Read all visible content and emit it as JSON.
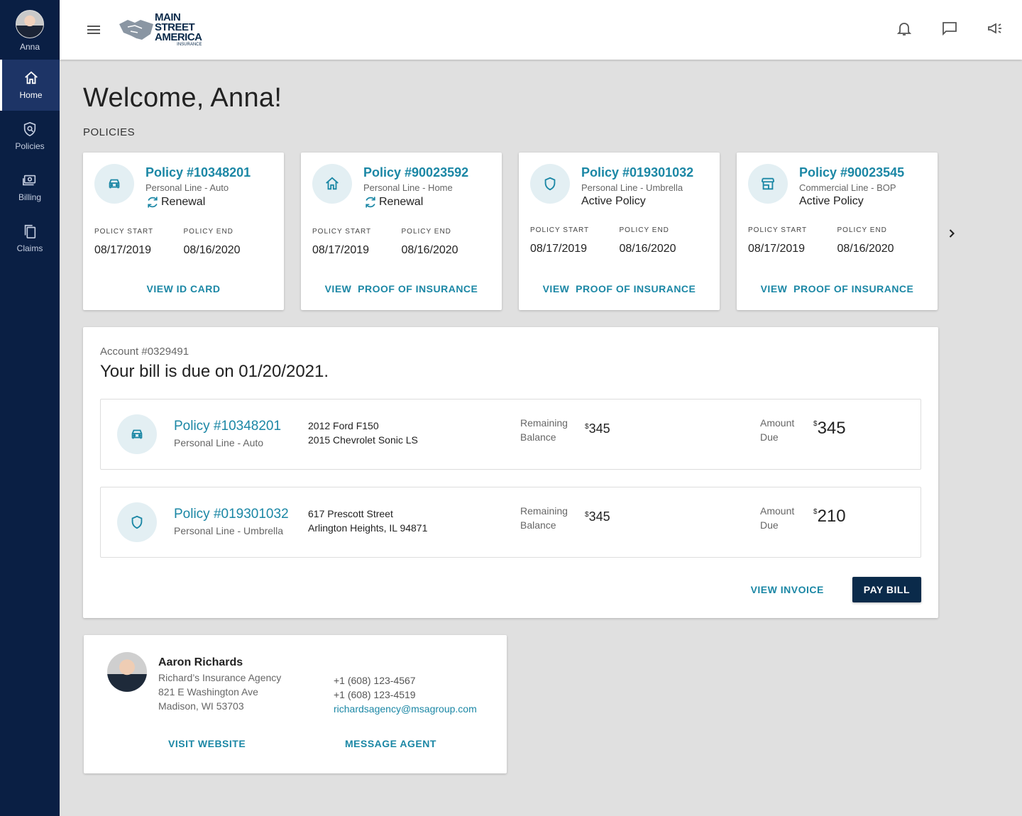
{
  "sidebar": {
    "user_name": "Anna",
    "items": [
      {
        "label": "Home",
        "icon": "home-icon",
        "active": true
      },
      {
        "label": "Policies",
        "icon": "policy-shield-icon",
        "active": false
      },
      {
        "label": "Billing",
        "icon": "billing-icon",
        "active": false
      },
      {
        "label": "Claims",
        "icon": "claims-icon",
        "active": false
      }
    ]
  },
  "header": {
    "logo_lines": [
      "MAIN",
      "STREET",
      "AMERICA"
    ],
    "logo_sub": "INSURANCE",
    "icons": [
      "bell-icon",
      "chat-icon",
      "megaphone-icon"
    ]
  },
  "main": {
    "welcome": "Welcome, Anna!",
    "policies_title": "POLICIES"
  },
  "policies": [
    {
      "number": "Policy #10348201",
      "line": "Personal Line - Auto",
      "status": "Renewal",
      "renewal": true,
      "icon": "car-icon",
      "start_label": "POLICY START",
      "start": "08/17/2019",
      "end_label": "POLICY END",
      "end": "08/16/2020",
      "link": "VIEW ID CARD"
    },
    {
      "number": "Policy #90023592",
      "line": "Personal Line - Home",
      "status": "Renewal",
      "renewal": true,
      "icon": "home-icon",
      "start_label": "POLICY START",
      "start": "08/17/2019",
      "end_label": "POLICY END",
      "end": "08/16/2020",
      "link": "VIEW  PROOF OF INSURANCE"
    },
    {
      "number": "Policy #019301032",
      "line": "Personal Line - Umbrella",
      "status": "Active Policy",
      "renewal": false,
      "icon": "shield-icon",
      "start_label": "POLICY START",
      "start": "08/17/2019",
      "end_label": "POLICY END",
      "end": "08/16/2020",
      "link": "VIEW  PROOF OF INSURANCE"
    },
    {
      "number": "Policy #90023545",
      "line": "Commercial Line - BOP",
      "status": "Active Policy",
      "renewal": false,
      "icon": "store-icon",
      "start_label": "POLICY START",
      "start": "08/17/2019",
      "end_label": "POLICY END",
      "end": "08/16/2020",
      "link": "VIEW  PROOF OF INSURANCE"
    }
  ],
  "bill": {
    "account": "Account #0329491",
    "due_text": "Your bill is due on 01/20/2021.",
    "rows": [
      {
        "number": "Policy #10348201",
        "line": "Personal Line - Auto",
        "icon": "car-icon",
        "desc1": "2012 Ford F150",
        "desc2": "2015 Chevrolet Sonic LS",
        "rem_label1": "Remaining",
        "rem_label2": "Balance",
        "currency": "$",
        "remaining": "345",
        "amt_label1": "Amount",
        "amt_label2": "Due",
        "amount": "345"
      },
      {
        "number": "Policy #019301032",
        "line": "Personal Line - Umbrella",
        "icon": "shield-icon",
        "desc1": "617 Prescott Street",
        "desc2": "Arlington Heights, IL 94871",
        "rem_label1": "Remaining",
        "rem_label2": "Balance",
        "currency": "$",
        "remaining": "345",
        "amt_label1": "Amount",
        "amt_label2": "Due",
        "amount": "210"
      }
    ],
    "view_invoice": "VIEW INVOICE",
    "pay_bill": "PAY BILL"
  },
  "agent": {
    "name": "Aaron Richards",
    "agency": "Richard’s Insurance Agency",
    "address1": "821 E Washington Ave",
    "address2": "Madison, WI 53703",
    "phone1": "+1 (608) 123-4567",
    "phone2": "+1 (608) 123-4519",
    "email": "richardsagency@msagroup.com",
    "visit_website": "VISIT WEBSITE",
    "message_agent": "MESSAGE AGENT"
  },
  "colors": {
    "sidebar": "#0a1f44",
    "accent": "#1b87a5",
    "primary_button": "#0a2a4a",
    "background": "#e0e0e0"
  }
}
